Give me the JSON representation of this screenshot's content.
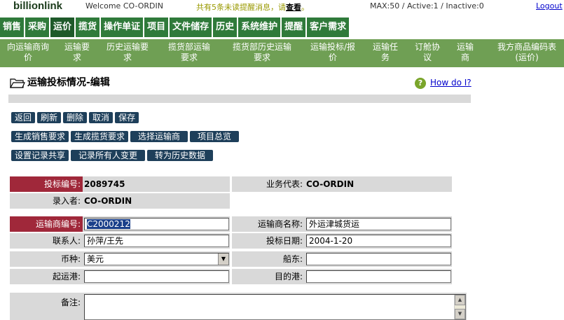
{
  "topbar": {
    "logo": "billionlink",
    "welcome": "Welcome CO-ORDIN",
    "notice_prefix": "共有5条未读提醒消息，请",
    "notice_link": "查看",
    "notice_suffix": "。",
    "stats": "MAX:50 / Active:1 / Inactive:0",
    "logout": "Logout"
  },
  "mainnav": [
    "销售",
    "采购",
    "运价",
    "揽货",
    "操作单证",
    "项目",
    "文件储存",
    "历史",
    "系统维护",
    "提醒",
    "客户需求"
  ],
  "mainnav_active": "运价",
  "subnav": [
    "向运输商询\n价",
    "运输要\n求",
    "历史运输要\n求",
    "揽货部运输\n要求",
    "揽货部历史运输\n要求",
    "运输投标/报\n价",
    "运输任\n务",
    "订舱协\n议",
    "运输\n商",
    "我方商品编码表\n(运价)"
  ],
  "page": {
    "title": "运输投标情况-编辑",
    "help": "How do I?"
  },
  "buttons": {
    "row1": [
      "返回",
      "刷新",
      "删除",
      "取消",
      "保存"
    ],
    "row2": [
      "生成销售要求",
      "生成揽货要求",
      "选择运输商",
      "项目总览"
    ],
    "row3": [
      "设置记录共享",
      "记录所有人变更",
      "转为历史数据"
    ]
  },
  "form": {
    "bid_no_label": "投标编号:",
    "bid_no": "2089745",
    "sales_rep_label": "业务代表:",
    "sales_rep": "CO-ORDIN",
    "entered_by_label": "录入者:",
    "entered_by": "CO-ORDIN",
    "carrier_no_label": "运输商编号:",
    "carrier_no": "C2000212",
    "carrier_name_label": "运输商名称:",
    "carrier_name": "外运津城货运",
    "contact_label": "联系人:",
    "contact": "孙萍/王先",
    "bid_date_label": "投标日期:",
    "bid_date": "2004-1-20",
    "currency_label": "币种:",
    "currency": "美元",
    "shipowner_label": "船东:",
    "shipowner": "",
    "origin_port_label": "起运港:",
    "origin_port": "",
    "dest_port_label": "目的港:",
    "dest_port": "",
    "remarks_label": "备注:",
    "remarks": ""
  }
}
